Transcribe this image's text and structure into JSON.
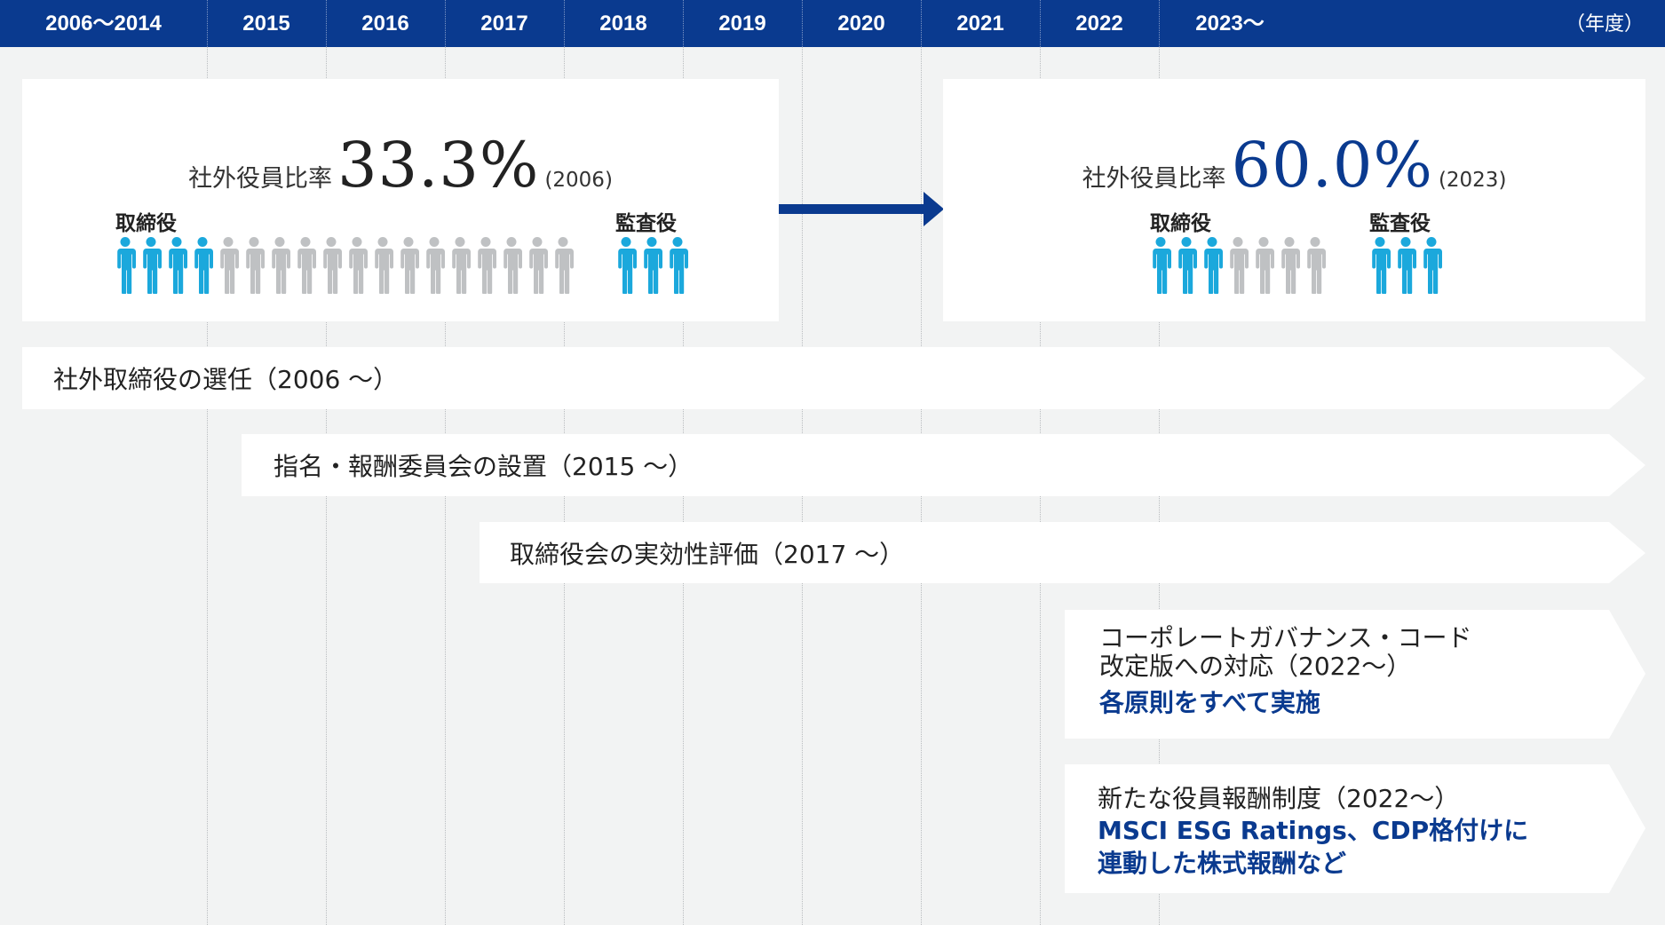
{
  "header": {
    "years": [
      "2006〜2014",
      "2015",
      "2016",
      "2017",
      "2018",
      "2019",
      "2020",
      "2021",
      "2022",
      "2023〜"
    ],
    "unit_label": "（年度）"
  },
  "before": {
    "ratio_label": "社外役員比率",
    "ratio_value": "33.3%",
    "ratio_year": "(2006)",
    "directors_label": "取締役",
    "auditors_label": "監査役",
    "directors_outside": 4,
    "directors_total": 18,
    "auditors_outside": 3,
    "auditors_total": 3
  },
  "after": {
    "ratio_label": "社外役員比率",
    "ratio_value": "60.0%",
    "ratio_year": "(2023)",
    "directors_label": "取締役",
    "auditors_label": "監査役",
    "directors_outside": 3,
    "directors_total": 7,
    "auditors_outside": 3,
    "auditors_total": 3
  },
  "initiatives": [
    {
      "text": "社外取締役の選任（2006 〜）"
    },
    {
      "text": "指名・報酬委員会の設置（2015 〜）"
    },
    {
      "text": "取締役会の実効性評価（2017 〜）"
    },
    {
      "line1": "コーポレートガバナンス・コード",
      "line2": "改定版への対応（2022〜）",
      "sub1": "各原則をすべて実施"
    },
    {
      "line1": "新たな役員報酬制度（2022〜）",
      "sub1": "MSCI ESG Ratings、CDP格付けに",
      "sub2": "連動した株式報酬など"
    }
  ],
  "colors": {
    "navy": "#0a3a8f",
    "outside_person": "#1ba8dc",
    "inside_person": "#bfc1c3",
    "ratio_before": "#222222",
    "ratio_after": "#0a3a8f"
  }
}
